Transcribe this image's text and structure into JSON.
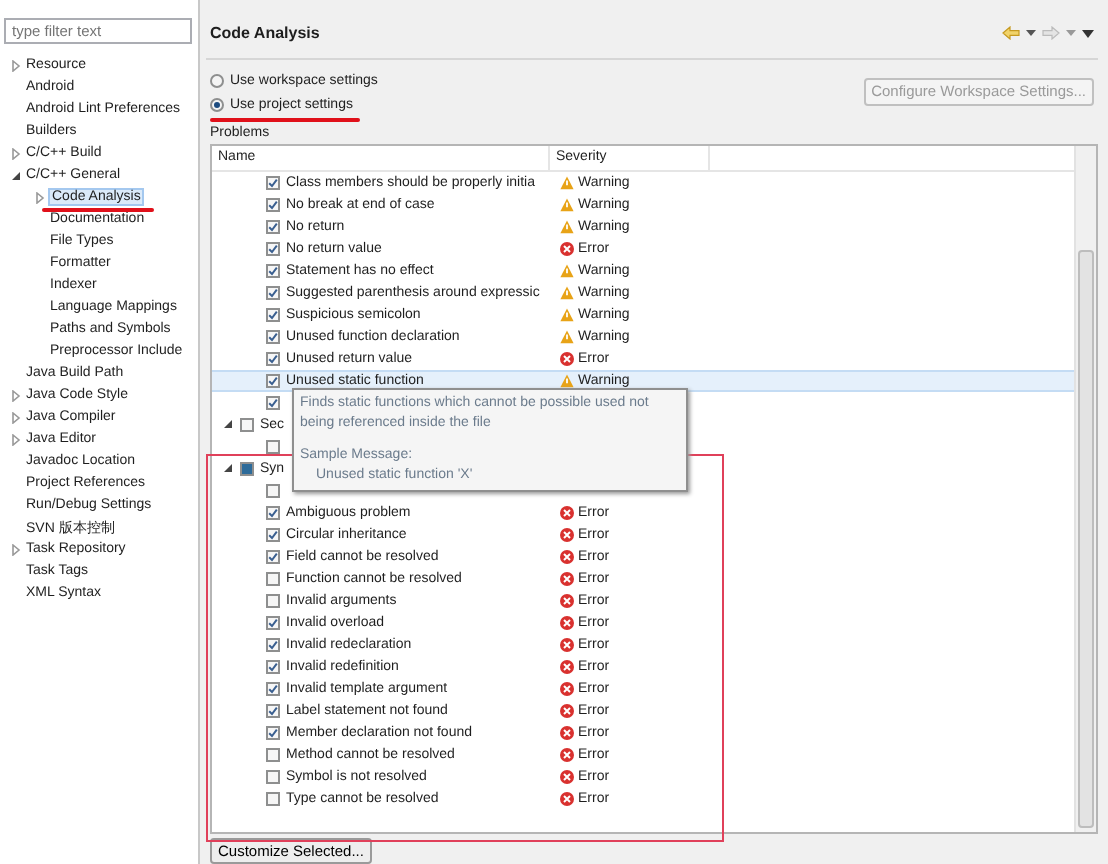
{
  "sidebar": {
    "filter": {
      "placeholder": "type filter text"
    },
    "items": [
      {
        "label": "Resource",
        "expanded": false,
        "selected": false
      },
      {
        "label": "Android",
        "selected": false
      },
      {
        "label": "Android Lint Preferences",
        "selected": false
      },
      {
        "label": "Builders",
        "selected": false
      },
      {
        "label": "C/C++ Build",
        "expanded": false,
        "selected": false
      },
      {
        "label": "C/C++ General",
        "expanded": true,
        "selected": false,
        "children": [
          {
            "label": "Code Analysis",
            "expanded": false,
            "selected": true
          },
          {
            "label": "Documentation",
            "selected": false
          },
          {
            "label": "File Types",
            "selected": false
          },
          {
            "label": "Formatter",
            "selected": false
          },
          {
            "label": "Indexer",
            "selected": false
          },
          {
            "label": "Language Mappings",
            "selected": false
          },
          {
            "label": "Paths and Symbols",
            "selected": false
          },
          {
            "label": "Preprocessor Include",
            "selected": false
          }
        ]
      },
      {
        "label": "Java Build Path",
        "selected": false
      },
      {
        "label": "Java Code Style",
        "expanded": false,
        "selected": false
      },
      {
        "label": "Java Compiler",
        "expanded": false,
        "selected": false
      },
      {
        "label": "Java Editor",
        "expanded": false,
        "selected": false
      },
      {
        "label": "Javadoc Location",
        "selected": false
      },
      {
        "label": "Project References",
        "selected": false
      },
      {
        "label": "Run/Debug Settings",
        "selected": false
      },
      {
        "label": "SVN 版本控制",
        "selected": false
      },
      {
        "label": "Task Repository",
        "expanded": false,
        "selected": false
      },
      {
        "label": "Task Tags",
        "selected": false
      },
      {
        "label": "XML Syntax",
        "selected": false
      }
    ]
  },
  "page": {
    "title": "Code Analysis",
    "options": [
      {
        "label": "Use workspace settings",
        "selected": false
      },
      {
        "label": "Use project settings",
        "selected": true
      }
    ],
    "configure_button": {
      "label": "Configure Workspace Settings...",
      "disabled": true
    },
    "problems_label": "Problems",
    "table": {
      "columns": [
        "Name",
        "Severity"
      ],
      "rows": [
        {
          "kind": "item",
          "name": "Class members should be properly initia",
          "severity": "Warning",
          "checked": true,
          "selected": false
        },
        {
          "kind": "item",
          "name": "No break at end of case",
          "severity": "Warning",
          "checked": true,
          "selected": false
        },
        {
          "kind": "item",
          "name": "No return",
          "severity": "Warning",
          "checked": true,
          "selected": false
        },
        {
          "kind": "item",
          "name": "No return value",
          "severity": "Error",
          "checked": true,
          "selected": false
        },
        {
          "kind": "item",
          "name": "Statement has no effect",
          "severity": "Warning",
          "checked": true,
          "selected": false
        },
        {
          "kind": "item",
          "name": "Suggested parenthesis around expressic",
          "severity": "Warning",
          "checked": true,
          "selected": false
        },
        {
          "kind": "item",
          "name": "Suspicious semicolon",
          "severity": "Warning",
          "checked": true,
          "selected": false
        },
        {
          "kind": "item",
          "name": "Unused function declaration",
          "severity": "Warning",
          "checked": true,
          "selected": false
        },
        {
          "kind": "item",
          "name": "Unused return value",
          "severity": "Error",
          "checked": true,
          "selected": false
        },
        {
          "kind": "item",
          "name": "Unused static function",
          "severity": "Warning",
          "checked": true,
          "selected": true
        },
        {
          "kind": "covered",
          "checked": true
        },
        {
          "kind": "group",
          "name": "Sec",
          "partial": false,
          "expanded": true
        },
        {
          "kind": "covered",
          "checked": false
        },
        {
          "kind": "group",
          "name": "Syn",
          "partial": true,
          "expanded": true
        },
        {
          "kind": "covered",
          "checked": false
        },
        {
          "kind": "item",
          "name": "Ambiguous problem",
          "severity": "Error",
          "checked": true,
          "selected": false
        },
        {
          "kind": "item",
          "name": "Circular inheritance",
          "severity": "Error",
          "checked": true,
          "selected": false
        },
        {
          "kind": "item",
          "name": "Field cannot be resolved",
          "severity": "Error",
          "checked": true,
          "selected": false
        },
        {
          "kind": "item",
          "name": "Function cannot be resolved",
          "severity": "Error",
          "checked": false,
          "selected": false
        },
        {
          "kind": "item",
          "name": "Invalid arguments",
          "severity": "Error",
          "checked": false,
          "selected": false
        },
        {
          "kind": "item",
          "name": "Invalid overload",
          "severity": "Error",
          "checked": true,
          "selected": false
        },
        {
          "kind": "item",
          "name": "Invalid redeclaration",
          "severity": "Error",
          "checked": true,
          "selected": false
        },
        {
          "kind": "item",
          "name": "Invalid redefinition",
          "severity": "Error",
          "checked": true,
          "selected": false
        },
        {
          "kind": "item",
          "name": "Invalid template argument",
          "severity": "Error",
          "checked": true,
          "selected": false
        },
        {
          "kind": "item",
          "name": "Label statement not found",
          "severity": "Error",
          "checked": true,
          "selected": false
        },
        {
          "kind": "item",
          "name": "Member declaration not found",
          "severity": "Error",
          "checked": true,
          "selected": false
        },
        {
          "kind": "item",
          "name": "Method cannot be resolved",
          "severity": "Error",
          "checked": false,
          "selected": false
        },
        {
          "kind": "item",
          "name": "Symbol is not resolved",
          "severity": "Error",
          "checked": false,
          "selected": false
        },
        {
          "kind": "item",
          "name": "Type cannot be resolved",
          "severity": "Error",
          "checked": false,
          "selected": false
        }
      ]
    },
    "tooltip": {
      "description": "Finds static functions which cannot be possible used not being referenced inside the file",
      "sample_label": "Sample Message:",
      "sample": "Unused static function 'X'"
    },
    "customize_button": {
      "label": "Customize Selected..."
    }
  }
}
